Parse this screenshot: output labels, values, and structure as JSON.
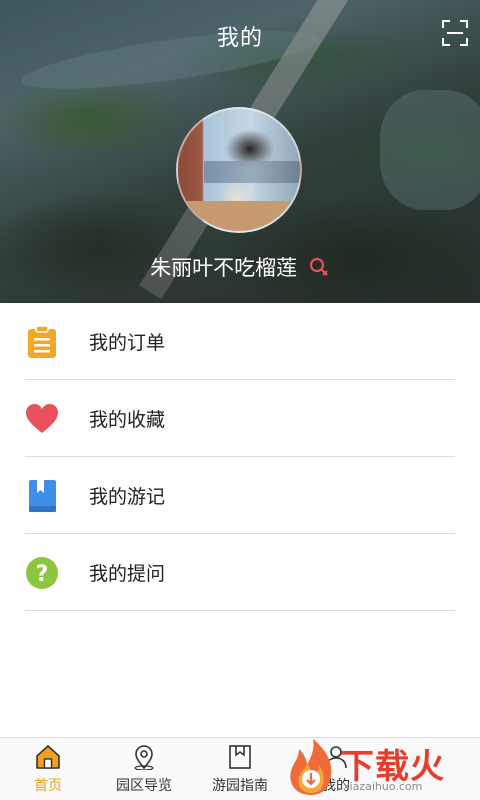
{
  "header": {
    "title": "我的",
    "scan_icon": "scan-icon",
    "username": "朱丽叶不吃榴莲",
    "gender_icon": "female-icon",
    "gender_color": "#e8505b"
  },
  "menu": {
    "items": [
      {
        "label": "我的订单",
        "icon": "clipboard-icon",
        "color": "#f5a623"
      },
      {
        "label": "我的收藏",
        "icon": "heart-icon",
        "color": "#e8505b"
      },
      {
        "label": "我的游记",
        "icon": "book-icon",
        "color": "#3f8fe8"
      },
      {
        "label": "我的提问",
        "icon": "question-icon",
        "color": "#8cc63f"
      }
    ]
  },
  "bottom_nav": {
    "items": [
      {
        "label": "首页",
        "icon": "home-icon",
        "active": true
      },
      {
        "label": "园区导览",
        "icon": "location-pin-icon",
        "active": false
      },
      {
        "label": "游园指南",
        "icon": "guide-book-icon",
        "active": false
      },
      {
        "label": "我的",
        "icon": "person-icon",
        "active": false
      }
    ],
    "active_color": "#f0a21b"
  },
  "watermark": {
    "text": "下载火",
    "sub": "xiazaihuo.com"
  }
}
